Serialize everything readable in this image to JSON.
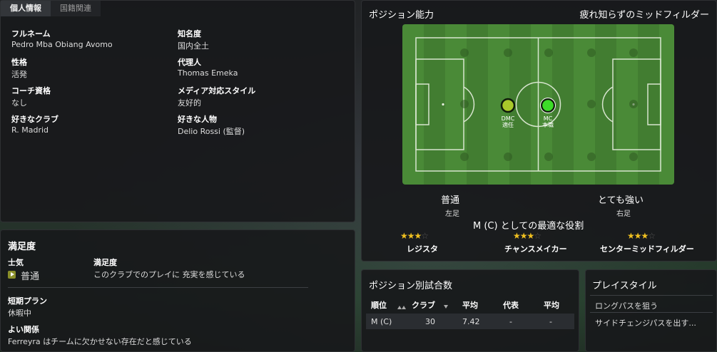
{
  "tabs": [
    "個人情報",
    "国籍関連"
  ],
  "personal": {
    "fullname_label": "フルネーム",
    "fullname": "Pedro Mba Obiang Avomo",
    "fame_label": "知名度",
    "fame": "国内全土",
    "personality_label": "性格",
    "personality": "活発",
    "agent_label": "代理人",
    "agent": "Thomas Emeka",
    "coach_label": "コーチ資格",
    "coach": "なし",
    "media_label": "メディア対応スタイル",
    "media": "友好的",
    "club_label": "好きなクラブ",
    "club": "R. Madrid",
    "person_label": "好きな人物",
    "person": "Delio Rossi (監督)"
  },
  "satisfaction": {
    "title": "満足度",
    "morale_label": "士気",
    "morale_value": "普通",
    "satisfaction_label": "満足度",
    "satisfaction_value": "このクラブでのプレイに 充実を感じている",
    "plan_label": "短期プラン",
    "plan_value": "休暇中",
    "relations_label": "よい関係",
    "relations_value": "Ferreyra はチームに欠かせない存在だと感じている"
  },
  "position_ability": {
    "title": "ポジション能力",
    "trait": "疲れ知らずのミッドフィルダー",
    "markers": [
      {
        "code": "DMC",
        "rating": "適任"
      },
      {
        "code": "MC",
        "rating": "本職"
      }
    ],
    "left_foot_rating": "普通",
    "left_foot_label": "左足",
    "right_foot_rating": "とても強い",
    "right_foot_label": "右足",
    "best_role_title": "M (C) としての最適な役割",
    "roles": [
      {
        "name": "レジスタ",
        "stars": 3
      },
      {
        "name": "チャンスメイカー",
        "stars": 3
      },
      {
        "name": "センターミッドフィルダー",
        "stars": 3
      }
    ]
  },
  "apps": {
    "title": "ポジション別試合数",
    "headers": [
      "順位",
      "クラブ",
      "平均",
      "代表",
      "平均"
    ],
    "row": [
      "M (C)",
      "30",
      "7.42",
      "-",
      "-"
    ]
  },
  "playstyle": {
    "title": "プレイスタイル",
    "items": [
      "ロングパスを狙う",
      "サイドチェンジパスを出す..."
    ]
  },
  "colors": {
    "natural": "#3cdc28",
    "accomplished": "#a8c82a",
    "star": "#f0c020"
  }
}
